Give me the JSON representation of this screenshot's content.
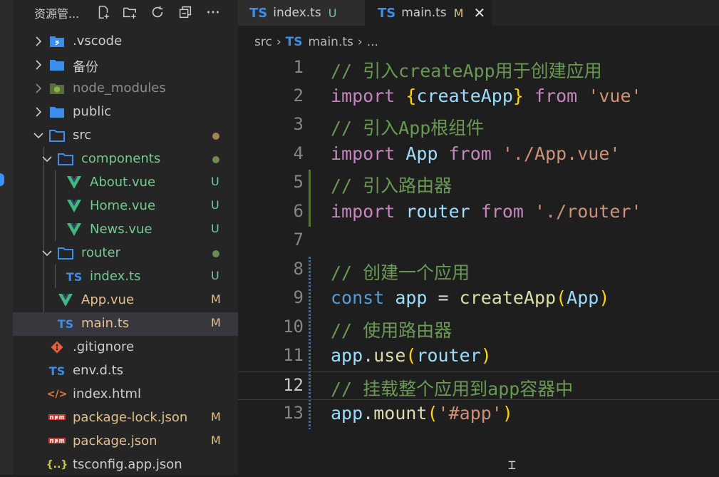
{
  "colors": {
    "accent": "#3794ff",
    "untracked": "#73c991",
    "modified": "#e2c08d",
    "ts": "#3b8eea",
    "vue": "#41b883"
  },
  "explorer": {
    "title": "资源管...",
    "actions": [
      "new-file-icon",
      "new-folder-icon",
      "refresh-icon",
      "collapse-all-icon",
      "more-icon"
    ],
    "items": [
      {
        "name": ".vscode",
        "status": ""
      },
      {
        "name": "备份",
        "status": ""
      },
      {
        "name": "node_modules",
        "status": ""
      },
      {
        "name": "public",
        "status": ""
      },
      {
        "name": "src",
        "status": "dot"
      },
      {
        "name": "components",
        "status": "dot"
      },
      {
        "name": "About.vue",
        "status": "U"
      },
      {
        "name": "Home.vue",
        "status": "U"
      },
      {
        "name": "News.vue",
        "status": "U"
      },
      {
        "name": "router",
        "status": "dot"
      },
      {
        "name": "index.ts",
        "status": "U"
      },
      {
        "name": "App.vue",
        "status": "M"
      },
      {
        "name": "main.ts",
        "status": "M"
      },
      {
        "name": ".gitignore",
        "status": ""
      },
      {
        "name": "env.d.ts",
        "status": ""
      },
      {
        "name": "index.html",
        "status": ""
      },
      {
        "name": "package-lock.json",
        "status": "M"
      },
      {
        "name": "package.json",
        "status": "M"
      },
      {
        "name": "tsconfig.app.json",
        "status": ""
      }
    ]
  },
  "tabs": [
    {
      "lang": "TS",
      "label": "index.ts",
      "mark": "U"
    },
    {
      "lang": "TS",
      "label": "main.ts",
      "mark": "M",
      "close": "✕"
    }
  ],
  "breadcrumb": {
    "folder": "src",
    "lang": "TS",
    "file": "main.ts",
    "more": "..."
  },
  "editor": {
    "current_line": 12,
    "lines": [
      {
        "n": "1",
        "text": "// 引入createApp用于创建应用"
      },
      {
        "n": "2",
        "text": "import {createApp} from 'vue'"
      },
      {
        "n": "3",
        "text": "// 引入App根组件"
      },
      {
        "n": "4",
        "text": "import App from './App.vue'"
      },
      {
        "n": "5",
        "text": "// 引入路由器"
      },
      {
        "n": "6",
        "text": "import router from './router'"
      },
      {
        "n": "7",
        "text": ""
      },
      {
        "n": "8",
        "text": "// 创建一个应用"
      },
      {
        "n": "9",
        "text": "const app = createApp(App)"
      },
      {
        "n": "10",
        "text": "// 使用路由器"
      },
      {
        "n": "11",
        "text": "app.use(router)"
      },
      {
        "n": "12",
        "text": "// 挂载整个应用到app容器中"
      },
      {
        "n": "13",
        "text": "app.mount('#app')"
      }
    ]
  }
}
